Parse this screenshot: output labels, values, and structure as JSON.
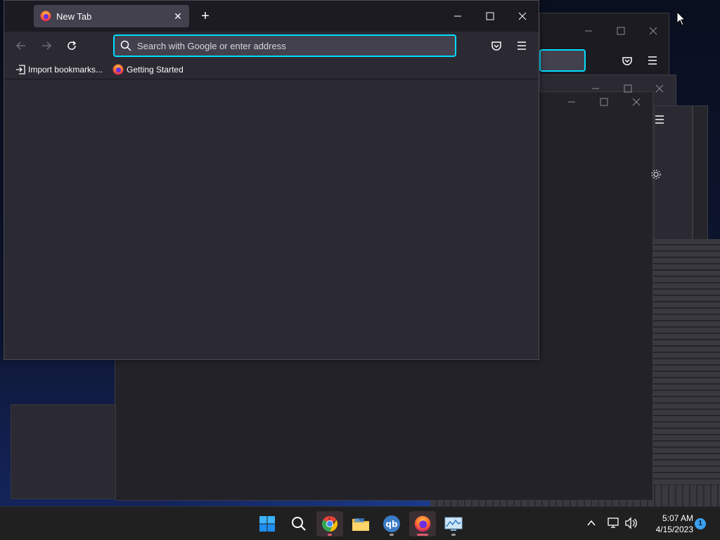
{
  "colors": {
    "accent_focus": "#00ddff",
    "titlebar": "#1c1b22",
    "toolbar": "#2b2a33",
    "tab_selected": "#42414d",
    "taskbar": "#202020",
    "notification_badge": "#3aa0f0"
  },
  "browser": {
    "tabs": [
      {
        "label": "New Tab",
        "icon": "firefox-icon",
        "selected": true
      }
    ],
    "window_controls": [
      "minimize-icon",
      "maximize-icon",
      "close-icon"
    ],
    "nav": {
      "back_icon": "back-arrow-icon",
      "forward_icon": "forward-arrow-icon",
      "reload_icon": "reload-icon",
      "back_enabled": false,
      "forward_enabled": false
    },
    "urlbar": {
      "placeholder": "Search with Google or enter address",
      "value": ""
    },
    "toolbar_right": [
      "pocket-icon",
      "hamburger-menu-icon"
    ],
    "bookmarks": [
      {
        "label": "Import bookmarks...",
        "icon": "import-icon"
      },
      {
        "label": "Getting Started",
        "icon": "firefox-icon"
      }
    ]
  },
  "taskbar": {
    "pinned": [
      {
        "name": "start-button",
        "icon": "windows-logo-icon"
      },
      {
        "name": "search-button",
        "icon": "search-icon"
      },
      {
        "name": "chrome",
        "icon": "chrome-icon",
        "running": true
      },
      {
        "name": "file-explorer",
        "icon": "folder-icon"
      },
      {
        "name": "qbittorrent",
        "icon": "qbittorrent-icon",
        "running": true
      },
      {
        "name": "firefox",
        "icon": "firefox-icon",
        "running": true,
        "active": true
      },
      {
        "name": "resource-monitor",
        "icon": "monitor-icon",
        "running": true
      }
    ],
    "tray": {
      "overflow_icon": "chevron-up-icon",
      "network_icon": "network-icon",
      "volume_icon": "volume-icon",
      "time": "5:07 AM",
      "date": "4/15/2023",
      "notification_count": "1"
    }
  }
}
